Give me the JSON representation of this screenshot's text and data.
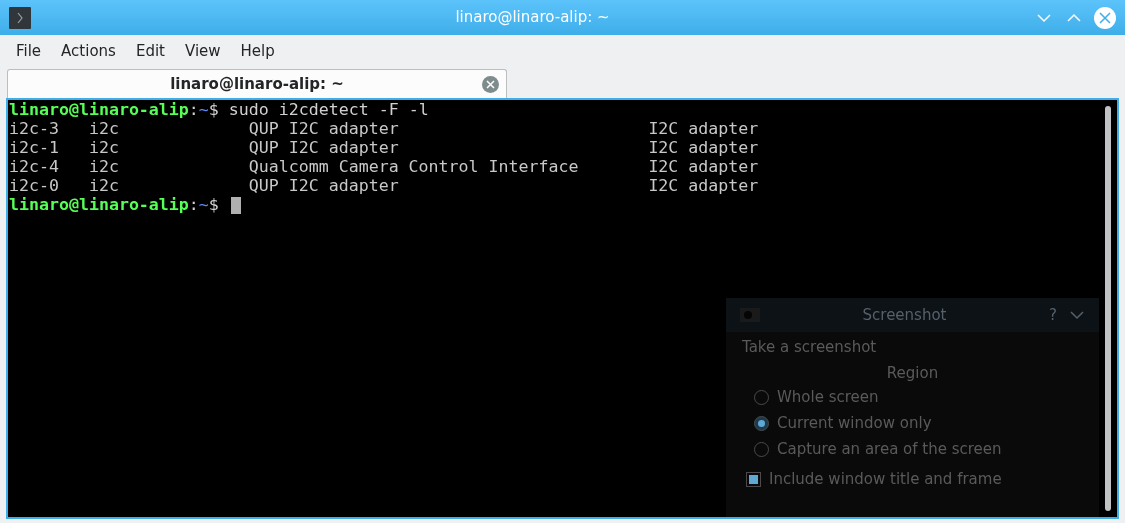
{
  "window": {
    "title": "linaro@linaro-alip: ~"
  },
  "menu": [
    "File",
    "Actions",
    "Edit",
    "View",
    "Help"
  ],
  "tabs": [
    {
      "label": "linaro@linaro-alip: ~",
      "selected": true
    }
  ],
  "terminal": {
    "lines": [
      {
        "kind": "prompt",
        "user": "linaro@linaro-alip",
        "sep": ":",
        "dir": "~",
        "symbol": "$",
        "command": "sudo i2cdetect -F -l"
      },
      {
        "kind": "output",
        "cells": [
          "i2c-3",
          "i2c",
          "QUP I2C adapter",
          "I2C adapter"
        ]
      },
      {
        "kind": "output",
        "cells": [
          "i2c-1",
          "i2c",
          "QUP I2C adapter",
          "I2C adapter"
        ]
      },
      {
        "kind": "output",
        "cells": [
          "i2c-4",
          "i2c",
          "Qualcomm Camera Control Interface",
          "I2C adapter"
        ]
      },
      {
        "kind": "output",
        "cells": [
          "i2c-0",
          "i2c",
          "QUP I2C adapter",
          "I2C adapter"
        ]
      },
      {
        "kind": "prompt",
        "user": "linaro@linaro-alip",
        "sep": ":",
        "dir": "~",
        "symbol": "$",
        "cursor": true
      }
    ]
  },
  "ghost_dialog": {
    "title": "Screenshot",
    "help": "?",
    "heading": "Take a screenshot",
    "group": "Region",
    "options": [
      {
        "label": "Whole screen",
        "selected": false
      },
      {
        "label": "Current window only",
        "selected": true
      },
      {
        "label": "Capture an area of the screen",
        "selected": false
      }
    ],
    "checkbox": {
      "label": "Include window title and frame",
      "checked": true
    }
  }
}
